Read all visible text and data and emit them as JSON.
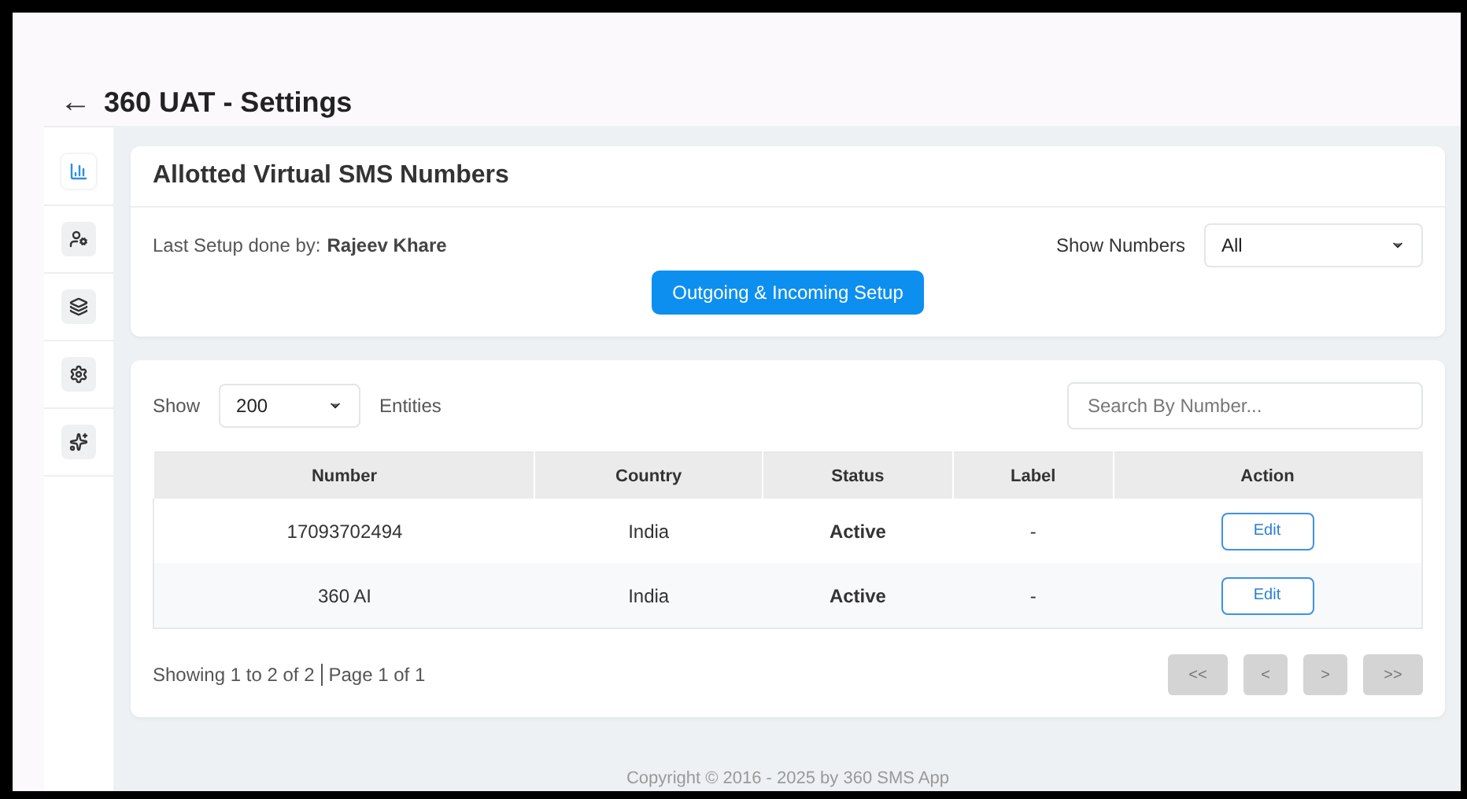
{
  "header": {
    "back_icon": "←",
    "title": "360 UAT - Settings"
  },
  "sidebar": {
    "items": [
      {
        "kind": "chart",
        "selected": true
      },
      {
        "kind": "user",
        "selected": false
      },
      {
        "kind": "layers",
        "selected": false
      },
      {
        "kind": "gear",
        "selected": false
      },
      {
        "kind": "sparkle",
        "selected": false
      }
    ]
  },
  "setup_card": {
    "title": "Allotted Virtual SMS Numbers",
    "last_setup_label": "Last Setup done by:",
    "last_setup_name": "Rajeev Khare",
    "show_numbers_label": "Show Numbers",
    "show_numbers_value": "All",
    "setup_button": "Outgoing & Incoming Setup"
  },
  "table_card": {
    "show_label": "Show",
    "page_size": "200",
    "entities_label": "Entities",
    "search": {
      "placeholder": "Search By Number..."
    },
    "columns": [
      "Number",
      "Country",
      "Status",
      "Label",
      "Action"
    ],
    "rows": [
      {
        "number": "17093702494",
        "country": "India",
        "status": "Active",
        "label": "-",
        "action": "Edit"
      },
      {
        "number": "360 AI",
        "country": "India",
        "status": "Active",
        "label": "-",
        "action": "Edit"
      }
    ],
    "summary": "Showing 1 to 2 of 2",
    "page_info": "Page 1 of 1",
    "pager": [
      {
        "label": "<<",
        "disabled": true
      },
      {
        "label": "<",
        "disabled": true
      },
      {
        "label": ">",
        "disabled": true
      },
      {
        "label": ">>",
        "disabled": true
      }
    ]
  },
  "footer": "Copyright © 2016 - 2025 by 360 SMS App"
}
